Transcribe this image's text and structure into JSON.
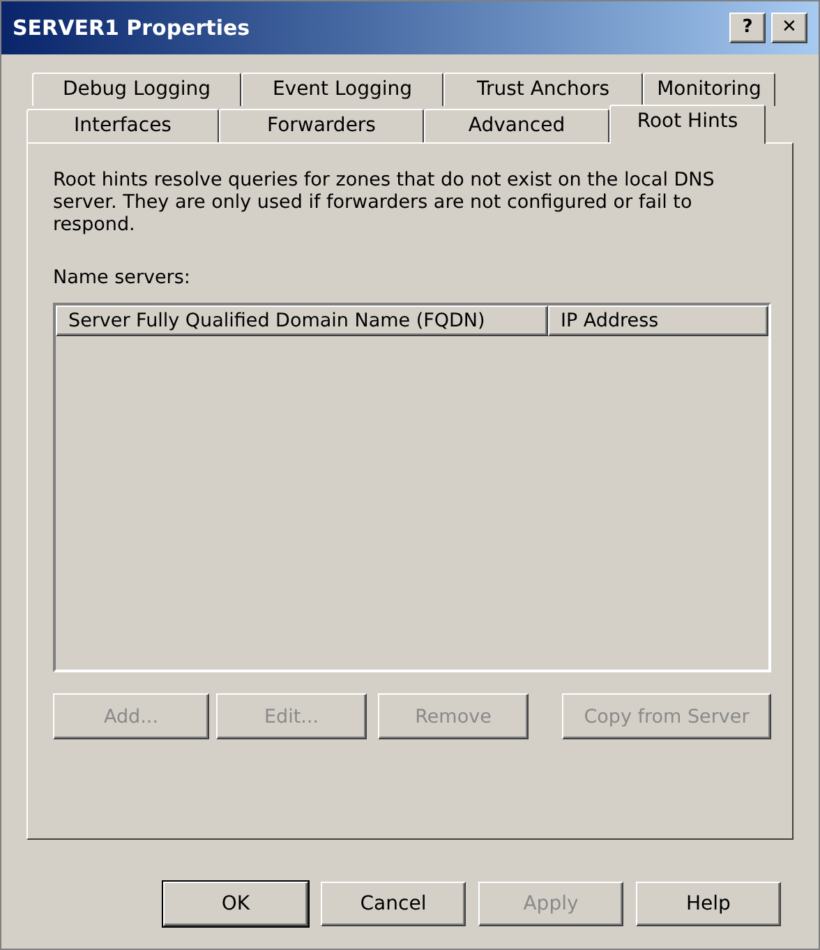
{
  "window": {
    "title": "SERVER1 Properties",
    "help_button": "?",
    "close_button": "✕"
  },
  "tab_rows": [
    [
      {
        "label": "Debug Logging",
        "selected": false
      },
      {
        "label": "Event Logging",
        "selected": false
      },
      {
        "label": "Trust Anchors",
        "selected": false
      },
      {
        "label": "Monitoring",
        "selected": false
      }
    ],
    [
      {
        "label": "Interfaces",
        "selected": false
      },
      {
        "label": "Forwarders",
        "selected": false
      },
      {
        "label": "Advanced",
        "selected": false
      },
      {
        "label": "Root Hints",
        "selected": true
      }
    ]
  ],
  "description": "Root hints resolve queries for zones that do not exist on the local DNS server.  They are only used if forwarders are not configured or fail to respond.",
  "name_servers": {
    "label": "Name servers:",
    "columns": [
      "Server Fully Qualified Domain Name (FQDN)",
      "IP Address"
    ]
  },
  "list_buttons": [
    {
      "label": "Add...",
      "disabled": true
    },
    {
      "label": "Edit...",
      "disabled": true
    },
    {
      "label": "Remove",
      "disabled": true
    },
    {
      "label": "Copy from Server",
      "disabled": true
    }
  ],
  "dialog_buttons": [
    {
      "label": "OK",
      "disabled": false,
      "default": true
    },
    {
      "label": "Cancel",
      "disabled": false,
      "default": false
    },
    {
      "label": "Apply",
      "disabled": true,
      "default": false
    },
    {
      "label": "Help",
      "disabled": false,
      "default": false
    }
  ]
}
